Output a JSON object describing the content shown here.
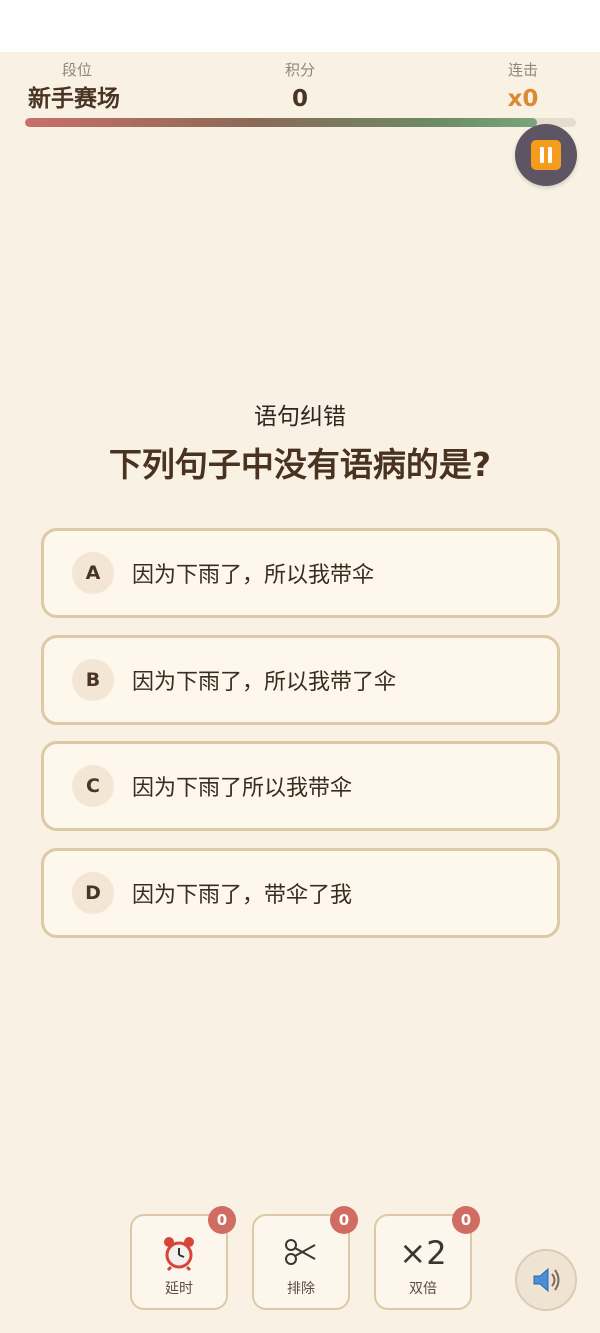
{
  "stats": {
    "rank_label": "段位",
    "rank_value": "新手赛场",
    "score_label": "积分",
    "score_value": "0",
    "combo_label": "连击",
    "combo_value": "x0"
  },
  "timer": {
    "remaining_fraction": 0.93
  },
  "question": {
    "type": "语句纠错",
    "text": "下列句子中没有语病的是?"
  },
  "options": [
    {
      "letter": "A",
      "text": "因为下雨了，所以我带伞"
    },
    {
      "letter": "B",
      "text": "因为下雨了，所以我带了伞"
    },
    {
      "letter": "C",
      "text": "因为下雨了所以我带伞"
    },
    {
      "letter": "D",
      "text": "因为下雨了，带伞了我"
    }
  ],
  "powerups": {
    "time": {
      "label": "延时",
      "count": "0",
      "icon": "alarm-clock-icon"
    },
    "eliminate": {
      "label": "排除",
      "count": "0",
      "icon": "scissors-icon"
    },
    "double": {
      "label": "双倍",
      "count": "0",
      "icon": "times-two-icon",
      "symbol": "×2"
    }
  },
  "colors": {
    "background": "#f8f1e4",
    "pause_button": "#5d5563",
    "pause_accent": "#f39c1e",
    "combo": "#d98a32",
    "badge": "#d06c62",
    "option_border": "#dcc9a5"
  }
}
